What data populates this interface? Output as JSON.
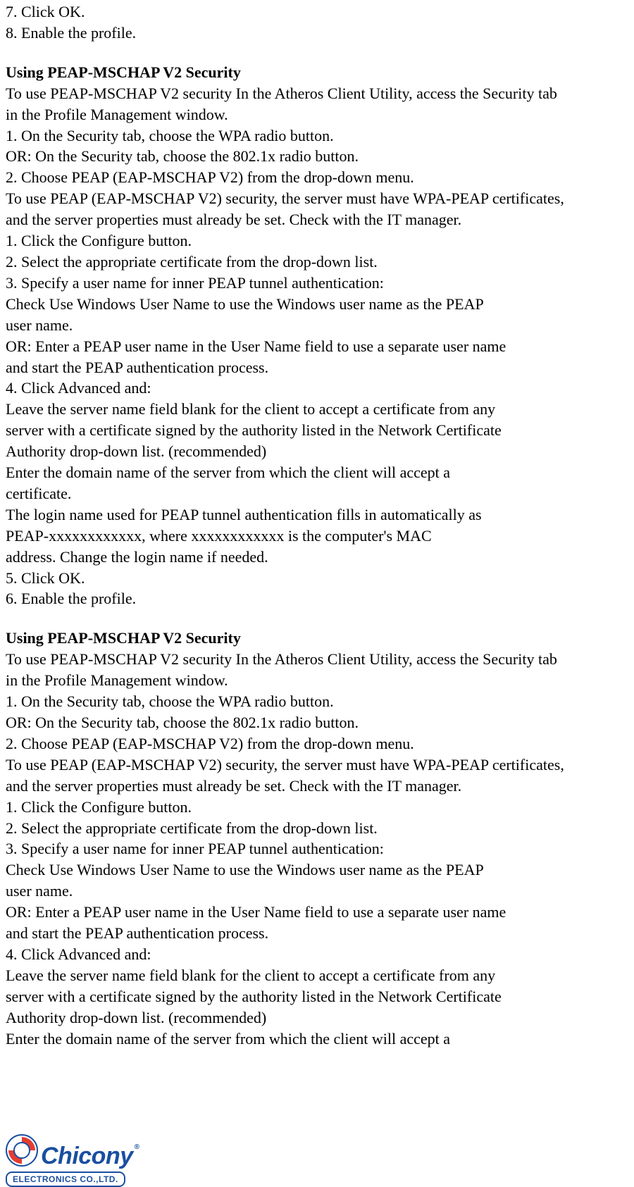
{
  "lines": [
    "7. Click OK.",
    "8. Enable the profile."
  ],
  "section1": {
    "heading": "Using PEAP-MSCHAP V2 Security",
    "body": [
      "To use PEAP-MSCHAP V2 security In the Atheros Client Utility, access the Security tab",
      "in the Profile Management window.",
      "1. On the Security tab, choose the WPA radio button.",
      "OR: On the Security tab, choose the 802.1x radio button.",
      "2. Choose PEAP (EAP-MSCHAP V2) from the drop-down menu.",
      "To use PEAP (EAP-MSCHAP V2) security, the server must have WPA-PEAP certificates,",
      "and the server properties must already be set. Check with the IT manager.",
      "1. Click the Configure button.",
      "2. Select the appropriate certificate from the drop-down list.",
      "3. Specify a user name for inner PEAP tunnel authentication:",
      "Check Use Windows User Name to use the Windows user name as the PEAP",
      "user name.",
      "OR: Enter a PEAP user name in the User Name field to use a separate user name",
      "and start the PEAP authentication process.",
      "4. Click Advanced and:",
      "Leave the server name field blank for the client to accept a certificate from any",
      "server with a certificate signed by the authority listed in the Network Certificate",
      "Authority drop-down list. (recommended)",
      "Enter the domain name of the server from which the client will accept a",
      "certificate.",
      "The login name used for PEAP tunnel authentication fills in automatically as",
      "PEAP-xxxxxxxxxxxx, where xxxxxxxxxxxx is the computer's MAC",
      "address. Change the login name if needed.",
      "5. Click OK.",
      "6. Enable the profile."
    ]
  },
  "section2": {
    "heading": "Using PEAP-MSCHAP V2 Security",
    "body": [
      "To use PEAP-MSCHAP V2 security In the Atheros Client Utility, access the Security tab",
      "in the Profile Management window.",
      "1. On the Security tab, choose the WPA radio button.",
      "OR: On the Security tab, choose the 802.1x radio button.",
      "2. Choose PEAP (EAP-MSCHAP V2) from the drop-down menu.",
      "To use PEAP (EAP-MSCHAP V2) security, the server must have WPA-PEAP certificates,",
      "and the server properties must already be set. Check with the IT manager.",
      "1. Click the Configure button.",
      "2. Select the appropriate certificate from the drop-down list.",
      "3. Specify a user name for inner PEAP tunnel authentication:",
      "Check Use Windows User Name to use the Windows user name as the PEAP",
      "user name.",
      "OR: Enter a PEAP user name in the User Name field to use a separate user name",
      "and start the PEAP authentication process.",
      "4. Click Advanced and:",
      "Leave the server name field blank for the client to accept a certificate from any",
      "server with a certificate signed by the authority listed in the Network Certificate",
      "Authority drop-down list. (recommended)",
      "Enter the domain name of the server from which the client will accept a"
    ]
  },
  "footer": {
    "brand": "Chicony",
    "company": "ELECTRONICS CO.,LTD."
  }
}
